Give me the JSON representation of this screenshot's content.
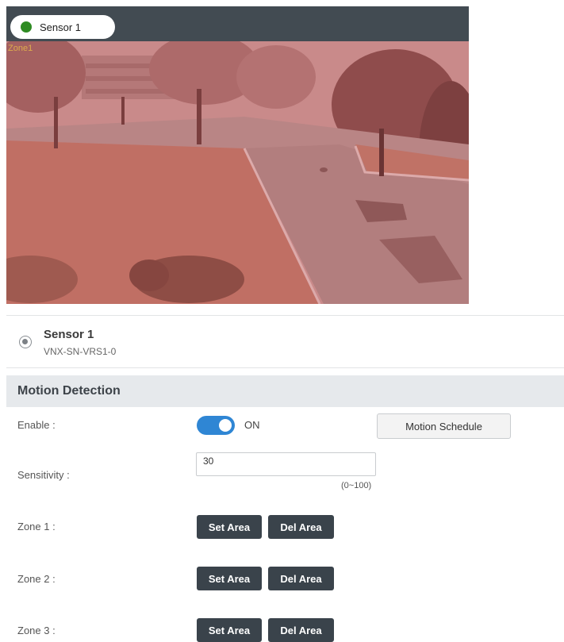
{
  "camera": {
    "sensor_pill_label": "Sensor 1",
    "zone_overlay_label": "Zone1",
    "status_color": "#2e8b22",
    "overlay_color": "#d96b6b"
  },
  "sensor": {
    "name": "Sensor 1",
    "model": "VNX-SN-VRS1-0"
  },
  "motion": {
    "section_title": "Motion Detection",
    "enable_label": "Enable :",
    "enable_state": "ON",
    "toggle_color": "#2f86d4",
    "schedule_button": "Motion Schedule",
    "sensitivity_label": "Sensitivity :",
    "sensitivity_value": "30",
    "sensitivity_range": "(0~100)",
    "zones": [
      {
        "label": "Zone 1 :",
        "set": "Set Area",
        "del": "Del Area"
      },
      {
        "label": "Zone 2 :",
        "set": "Set Area",
        "del": "Del Area"
      },
      {
        "label": "Zone 3 :",
        "set": "Set Area",
        "del": "Del Area"
      }
    ]
  }
}
